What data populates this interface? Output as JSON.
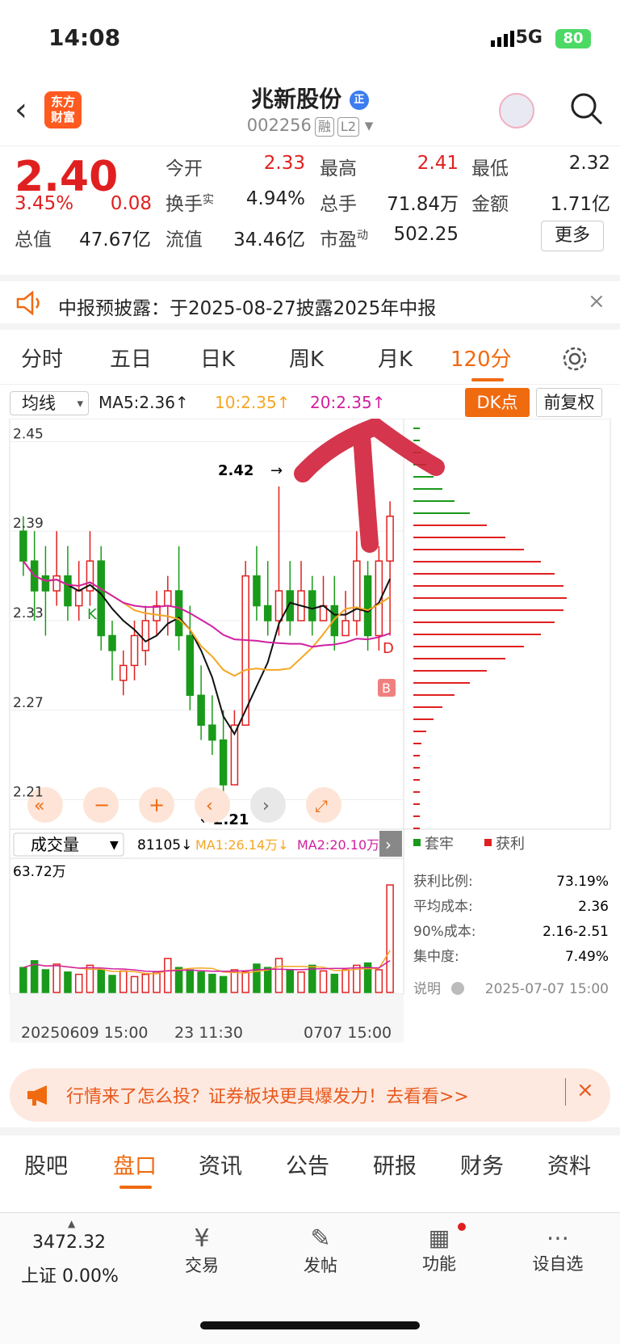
{
  "status": {
    "time": "14:08",
    "network": "5G",
    "battery": "80"
  },
  "header": {
    "title": "兆新股份",
    "code": "002256",
    "tag1": "融",
    "tag2": "L2",
    "logo_line1": "东方",
    "logo_line2": "财富"
  },
  "quote": {
    "price": "2.40",
    "change_pct": "3.45%",
    "change": "0.08",
    "r1": [
      {
        "label": "今开",
        "value": "2.33"
      },
      {
        "label": "最高",
        "value": "2.41"
      },
      {
        "label": "最低",
        "value": "2.32"
      }
    ],
    "r2": [
      {
        "label": "换手",
        "sup": "实",
        "value": "4.94%"
      },
      {
        "label": "总手",
        "value": "71.84万"
      },
      {
        "label": "金额",
        "value": "1.71亿"
      }
    ],
    "r3": [
      {
        "label": "总值",
        "value": "47.67亿"
      },
      {
        "label": "流值",
        "value": "34.46亿"
      },
      {
        "label": "市盈",
        "sup": "动",
        "value": "502.25"
      }
    ],
    "more": "更多"
  },
  "banner": {
    "text": "中报预披露：于2025-08-27披露2025年中报"
  },
  "tabs": [
    "分时",
    "五日",
    "日K",
    "周K",
    "月K",
    "120分"
  ],
  "chart_bar": {
    "ma_select": "均线",
    "ma5": "MA5:2.36↑",
    "ma10": "10:2.35↑",
    "ma20": "20:2.35↑",
    "dk": "DK点",
    "fq": "前复权"
  },
  "chart_data": {
    "type": "candlestick",
    "period": "120分",
    "y_ticks": [
      "2.45",
      "2.39",
      "2.33",
      "2.27",
      "2.21"
    ],
    "high_label": "2.42",
    "low_label": "2.21",
    "ylim": [
      2.2,
      2.46
    ],
    "candles": [
      [
        2.39,
        2.37,
        2.4,
        2.36
      ],
      [
        2.37,
        2.35,
        2.39,
        2.33
      ],
      [
        2.36,
        2.35,
        2.38,
        2.32
      ],
      [
        2.35,
        2.36,
        2.39,
        2.34
      ],
      [
        2.36,
        2.34,
        2.38,
        2.33
      ],
      [
        2.34,
        2.35,
        2.37,
        2.33
      ],
      [
        2.35,
        2.37,
        2.39,
        2.34
      ],
      [
        2.37,
        2.32,
        2.38,
        2.31
      ],
      [
        2.32,
        2.31,
        2.33,
        2.29
      ],
      [
        2.29,
        2.3,
        2.31,
        2.28
      ],
      [
        2.3,
        2.32,
        2.33,
        2.29
      ],
      [
        2.31,
        2.33,
        2.34,
        2.3
      ],
      [
        2.33,
        2.34,
        2.35,
        2.32
      ],
      [
        2.34,
        2.35,
        2.36,
        2.32
      ],
      [
        2.35,
        2.32,
        2.38,
        2.31
      ],
      [
        2.32,
        2.28,
        2.34,
        2.27
      ],
      [
        2.28,
        2.26,
        2.3,
        2.25
      ],
      [
        2.26,
        2.25,
        2.28,
        2.24
      ],
      [
        2.25,
        2.22,
        2.27,
        2.21
      ],
      [
        2.22,
        2.26,
        2.27,
        2.22
      ],
      [
        2.26,
        2.36,
        2.37,
        2.26
      ],
      [
        2.36,
        2.34,
        2.38,
        2.33
      ],
      [
        2.34,
        2.33,
        2.37,
        2.32
      ],
      [
        2.33,
        2.35,
        2.42,
        2.32
      ],
      [
        2.35,
        2.33,
        2.37,
        2.32
      ],
      [
        2.33,
        2.35,
        2.37,
        2.33
      ],
      [
        2.35,
        2.33,
        2.36,
        2.32
      ],
      [
        2.33,
        2.34,
        2.36,
        2.33
      ],
      [
        2.34,
        2.32,
        2.36,
        2.31
      ],
      [
        2.32,
        2.33,
        2.35,
        2.32
      ],
      [
        2.33,
        2.37,
        2.39,
        2.32
      ],
      [
        2.36,
        2.32,
        2.37,
        2.31
      ],
      [
        2.32,
        2.37,
        2.38,
        2.31
      ],
      [
        2.37,
        2.4,
        2.41,
        2.32
      ]
    ],
    "volume": {
      "label": "成交量",
      "value": "81105↓",
      "ma1": "MA1:26.14万↓",
      "ma2": "MA2:20.10万",
      "max": "63.72万",
      "bars": [
        0.22,
        0.28,
        0.2,
        0.25,
        0.18,
        0.16,
        0.24,
        0.2,
        0.15,
        0.19,
        0.14,
        0.16,
        0.18,
        0.3,
        0.22,
        0.2,
        0.18,
        0.16,
        0.14,
        0.2,
        0.18,
        0.25,
        0.22,
        0.3,
        0.2,
        0.18,
        0.24,
        0.19,
        0.16,
        0.2,
        0.24,
        0.26,
        0.2,
        0.95
      ]
    },
    "x_labels": [
      "20250609 15:00",
      "23 11:30",
      "0707 15:00"
    ]
  },
  "chip": {
    "legend1": "套牢",
    "legend2": "获利",
    "rows": [
      {
        "label": "获利比例:",
        "value": "73.19%"
      },
      {
        "label": "平均成本:",
        "value": "2.36"
      },
      {
        "label": "90%成本:",
        "value": "2.16-2.51"
      },
      {
        "label": "集中度:",
        "value": "7.49%"
      }
    ],
    "note": "说明",
    "date": "2025-07-07 15:00"
  },
  "promo": {
    "text": "行情来了怎么投？证券板块更具爆发力！去看看>>"
  },
  "bottom_tabs": [
    "股吧",
    "盘口",
    "资讯",
    "公告",
    "研报",
    "财务",
    "资料"
  ],
  "nav": {
    "index_value": "3472.32",
    "index_name": "上证",
    "index_change": "0.00%",
    "items": [
      "交易",
      "发帖",
      "功能",
      "设自选"
    ]
  }
}
